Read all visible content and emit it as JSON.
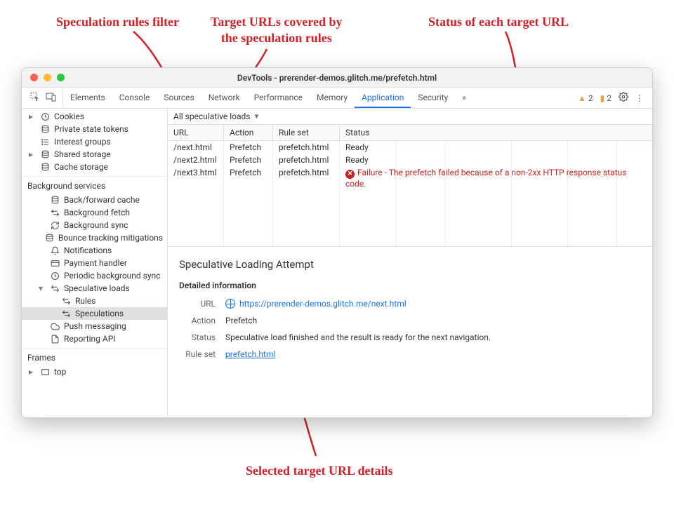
{
  "window": {
    "title": "DevTools - prerender-demos.glitch.me/prefetch.html"
  },
  "tabs": {
    "items": [
      "Elements",
      "Console",
      "Sources",
      "Network",
      "Performance",
      "Memory",
      "Application",
      "Security"
    ],
    "active": "Application",
    "more": "»",
    "warnings_count": "2",
    "messages_count": "2"
  },
  "sidebar": {
    "storage_items": [
      {
        "icon": "clock",
        "label": "Cookies",
        "caret": true
      },
      {
        "icon": "db",
        "label": "Private state tokens"
      },
      {
        "icon": "list",
        "label": "Interest groups"
      },
      {
        "icon": "db",
        "label": "Shared storage",
        "caret": true
      },
      {
        "icon": "db",
        "label": "Cache storage"
      }
    ],
    "bg_heading": "Background services",
    "bg_items": [
      {
        "icon": "db",
        "label": "Back/forward cache"
      },
      {
        "icon": "arrows",
        "label": "Background fetch"
      },
      {
        "icon": "sync",
        "label": "Background sync"
      },
      {
        "icon": "db",
        "label": "Bounce tracking mitigations"
      },
      {
        "icon": "bell",
        "label": "Notifications"
      },
      {
        "icon": "card",
        "label": "Payment handler"
      },
      {
        "icon": "clock",
        "label": "Periodic background sync"
      },
      {
        "icon": "arrows",
        "label": "Speculative loads",
        "expanded": true,
        "children": [
          {
            "icon": "arrows",
            "label": "Rules"
          },
          {
            "icon": "arrows",
            "label": "Speculations",
            "selected": true
          }
        ]
      },
      {
        "icon": "cloud",
        "label": "Push messaging"
      },
      {
        "icon": "doc",
        "label": "Reporting API"
      }
    ],
    "frames_heading": "Frames",
    "frames_items": [
      {
        "icon": "frame",
        "label": "top",
        "caret": true
      }
    ]
  },
  "filter": {
    "label": "All speculative loads"
  },
  "table": {
    "headers": [
      "URL",
      "Action",
      "Rule set",
      "Status"
    ],
    "rows": [
      {
        "url": "/next.html",
        "action": "Prefetch",
        "ruleset": "prefetch.html",
        "status": "Ready",
        "error": false
      },
      {
        "url": "/next2.html",
        "action": "Prefetch",
        "ruleset": "prefetch.html",
        "status": "Ready",
        "error": false
      },
      {
        "url": "/next3.html",
        "action": "Prefetch",
        "ruleset": "prefetch.html",
        "status": "Failure - The prefetch failed because of a non-2xx HTTP response status code.",
        "error": true
      }
    ]
  },
  "detail": {
    "title": "Speculative Loading Attempt",
    "section": "Detailed information",
    "url_label": "URL",
    "url_value": "https://prerender-demos.glitch.me/next.html",
    "action_label": "Action",
    "action_value": "Prefetch",
    "status_label": "Status",
    "status_value": "Speculative load finished and the result is ready for the next navigation.",
    "ruleset_label": "Rule set",
    "ruleset_value": "prefetch.html"
  },
  "annotations": {
    "a1": "Speculation rules filter",
    "a2": "Target URLs covered by\nthe speculation rules",
    "a3": "Status of each target URL",
    "a4": "Selected target URL details"
  }
}
